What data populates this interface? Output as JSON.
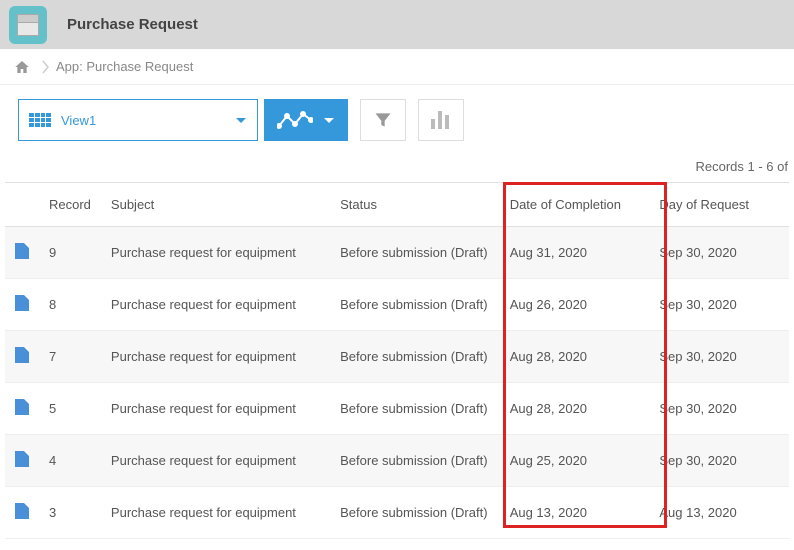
{
  "header": {
    "title": "Purchase Request"
  },
  "breadcrumb": {
    "path": "App: Purchase Request"
  },
  "toolbar": {
    "view_label": "View1"
  },
  "records_info": "Records 1 - 6 of",
  "columns": {
    "record": "Record",
    "subject": "Subject",
    "status": "Status",
    "completion": "Date of Completion",
    "request": "Day of Request"
  },
  "rows": [
    {
      "record": "9",
      "subject": "Purchase request for equipment",
      "status": "Before submission (Draft)",
      "completion": "Aug 31, 2020",
      "request": "Sep 30, 2020"
    },
    {
      "record": "8",
      "subject": "Purchase request for equipment",
      "status": "Before submission (Draft)",
      "completion": "Aug 26, 2020",
      "request": "Sep 30, 2020"
    },
    {
      "record": "7",
      "subject": "Purchase request for equipment",
      "status": "Before submission (Draft)",
      "completion": "Aug 28, 2020",
      "request": "Sep 30, 2020"
    },
    {
      "record": "5",
      "subject": "Purchase request for equipment",
      "status": "Before submission (Draft)",
      "completion": "Aug 28, 2020",
      "request": "Sep 30, 2020"
    },
    {
      "record": "4",
      "subject": "Purchase request for equipment",
      "status": "Before submission (Draft)",
      "completion": "Aug 25, 2020",
      "request": "Sep 30, 2020"
    },
    {
      "record": "3",
      "subject": "Purchase request for equipment",
      "status": "Before submission (Draft)",
      "completion": "Aug 13, 2020",
      "request": "Aug 13, 2020"
    }
  ]
}
